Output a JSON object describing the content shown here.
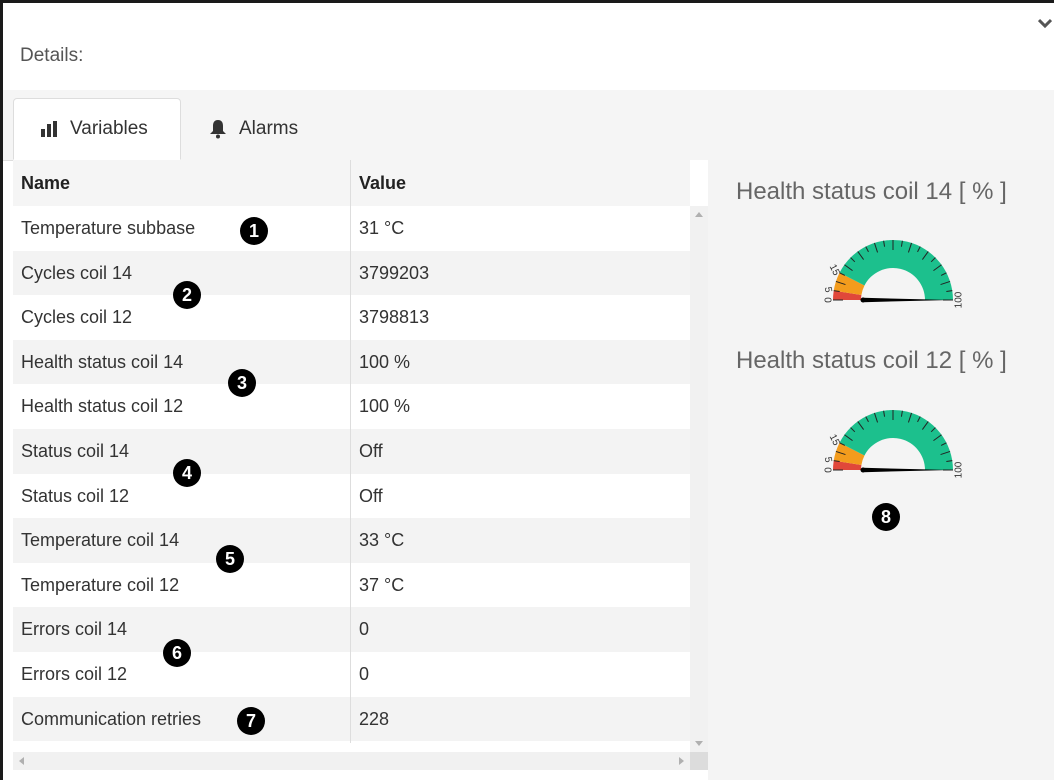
{
  "header": {
    "title": "Details:"
  },
  "tabs": [
    {
      "label": "Variables",
      "icon": "bar-chart-icon"
    },
    {
      "label": "Alarms",
      "icon": "bell-icon"
    }
  ],
  "table": {
    "columns": [
      "Name",
      "Value"
    ],
    "rows": [
      {
        "name": "Temperature subbase",
        "value": "31 °C"
      },
      {
        "name": "Cycles coil 14",
        "value": "3799203"
      },
      {
        "name": "Cycles coil 12",
        "value": "3798813"
      },
      {
        "name": "Health status coil 14",
        "value": "100 %"
      },
      {
        "name": "Health status coil 12",
        "value": "100 %"
      },
      {
        "name": "Status coil 14",
        "value": "Off"
      },
      {
        "name": "Status coil 12",
        "value": "Off"
      },
      {
        "name": "Temperature coil 14",
        "value": "33 °C"
      },
      {
        "name": "Temperature coil 12",
        "value": "37 °C"
      },
      {
        "name": "Errors coil 14",
        "value": "0"
      },
      {
        "name": "Errors coil 12",
        "value": "0"
      },
      {
        "name": "Communication retries",
        "value": "228"
      }
    ]
  },
  "markers": [
    "1",
    "2",
    "3",
    "4",
    "5",
    "6",
    "7",
    "8"
  ],
  "gauges": [
    {
      "title": "Health status coil 14 [ % ]",
      "value": 100,
      "labels": [
        "0",
        "5",
        "15",
        "100"
      ]
    },
    {
      "title": "Health status coil 12 [ % ]",
      "value": 100,
      "labels": [
        "0",
        "5",
        "15",
        "100"
      ]
    }
  ],
  "colors": {
    "red_band": "#e0473a",
    "orange_band": "#f39c1d",
    "green_band": "#1cc08d",
    "needle": "#000000"
  }
}
